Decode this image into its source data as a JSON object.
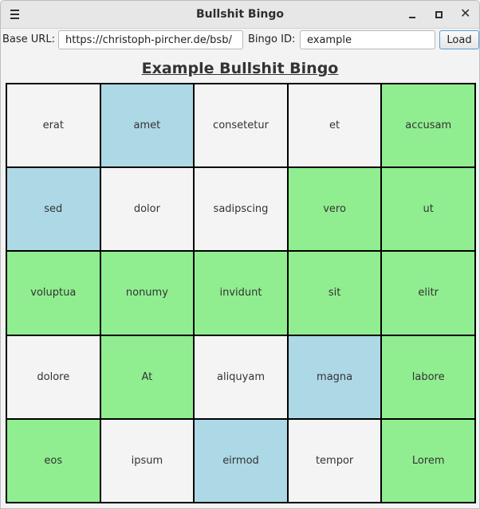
{
  "window": {
    "title": "Bullshit Bingo",
    "controls": {
      "minimize": "minimize",
      "maximize": "maximize",
      "close": "✕"
    }
  },
  "toolbar": {
    "base_url_label": "Base URL:",
    "base_url_value": "https://christoph-pircher.de/bsb/",
    "bingo_id_label": "Bingo ID:",
    "bingo_id_value": "example",
    "load_label": "Load"
  },
  "bingo": {
    "heading": "Example Bullshit Bingo",
    "colors": {
      "none": "#f4f4f4",
      "green": "#90ee90",
      "blue": "#add8e6"
    },
    "rows": [
      [
        {
          "word": "erat",
          "state": "none"
        },
        {
          "word": "amet",
          "state": "blue"
        },
        {
          "word": "consetetur",
          "state": "none"
        },
        {
          "word": "et",
          "state": "none"
        },
        {
          "word": "accusam",
          "state": "green"
        }
      ],
      [
        {
          "word": "sed",
          "state": "blue"
        },
        {
          "word": "dolor",
          "state": "none"
        },
        {
          "word": "sadipscing",
          "state": "none"
        },
        {
          "word": "vero",
          "state": "green"
        },
        {
          "word": "ut",
          "state": "green"
        }
      ],
      [
        {
          "word": "voluptua",
          "state": "green"
        },
        {
          "word": "nonumy",
          "state": "green"
        },
        {
          "word": "invidunt",
          "state": "green"
        },
        {
          "word": "sit",
          "state": "green"
        },
        {
          "word": "elitr",
          "state": "green"
        }
      ],
      [
        {
          "word": "dolore",
          "state": "none"
        },
        {
          "word": "At",
          "state": "green"
        },
        {
          "word": "aliquyam",
          "state": "none"
        },
        {
          "word": "magna",
          "state": "blue"
        },
        {
          "word": "labore",
          "state": "green"
        }
      ],
      [
        {
          "word": "eos",
          "state": "green"
        },
        {
          "word": "ipsum",
          "state": "none"
        },
        {
          "word": "eirmod",
          "state": "blue"
        },
        {
          "word": "tempor",
          "state": "none"
        },
        {
          "word": "Lorem",
          "state": "green"
        }
      ]
    ]
  }
}
